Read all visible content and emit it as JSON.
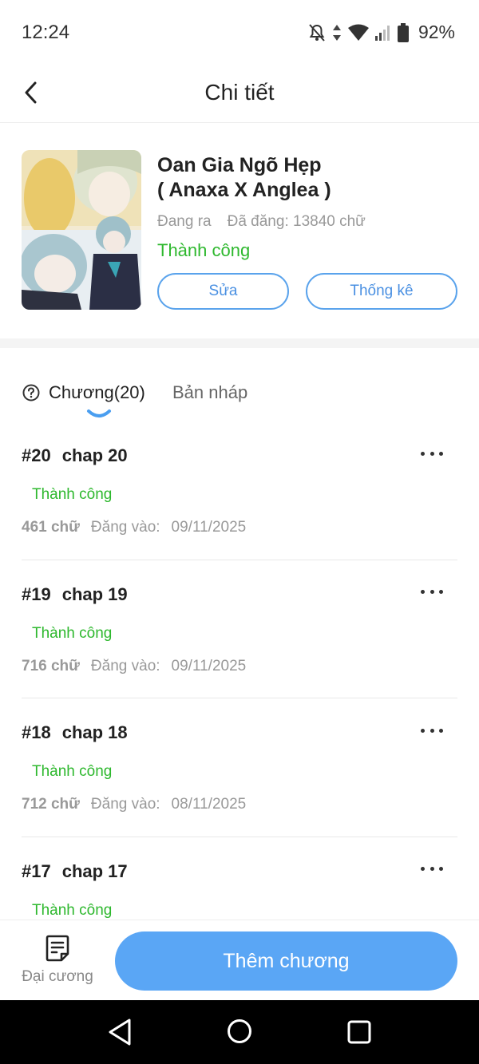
{
  "status_bar": {
    "time": "12:24",
    "battery": "92%",
    "icons": [
      "bell-off-icon",
      "data-arrows-icon",
      "wifi-icon",
      "signal-icon",
      "battery-icon"
    ]
  },
  "header": {
    "title": "Chi tiết",
    "back_icon": "chevron-left-icon"
  },
  "story": {
    "title_line1": "Oan Gia Ngõ Hẹp",
    "title_line2": "( Anaxa X Anglea )",
    "state": "Đang ra",
    "words": "Đã đăng: 13840 chữ",
    "status": "Thành công",
    "edit_label": "Sửa",
    "stats_label": "Thống kê"
  },
  "tabs": {
    "chapters": "Chương(20)",
    "drafts": "Bản nháp",
    "help_icon": "question-circle-icon"
  },
  "chapters": [
    {
      "num": "#20",
      "title": "chap 20",
      "status": "Thành công",
      "words": "461 chữ",
      "posted_label": "Đăng vào:",
      "date": "09/11/2025"
    },
    {
      "num": "#19",
      "title": "chap 19",
      "status": "Thành công",
      "words": "716 chữ",
      "posted_label": "Đăng vào:",
      "date": "09/11/2025"
    },
    {
      "num": "#18",
      "title": "chap 18",
      "status": "Thành công",
      "words": "712 chữ",
      "posted_label": "Đăng vào:",
      "date": "08/11/2025"
    },
    {
      "num": "#17",
      "title": "chap 17",
      "status": "Thành công",
      "words": "",
      "posted_label": "",
      "date": ""
    }
  ],
  "bottom_bar": {
    "outline_label": "Đại cương",
    "add_chapter_label": "Thêm chương"
  },
  "colors": {
    "accent_blue": "#5aa6f5",
    "success_green": "#2eb82e",
    "muted_gray": "#999999"
  }
}
